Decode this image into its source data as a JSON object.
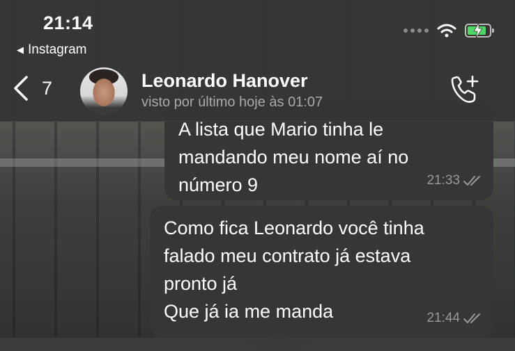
{
  "status_bar": {
    "time": "21:14",
    "back_app_label": "Instagram",
    "back_app_arrow": "◀",
    "icons": [
      "signal-dots-icon",
      "wifi-icon",
      "battery-charging-icon"
    ],
    "battery_color": "#4cd964"
  },
  "header": {
    "back_icon": "chevron-left-icon",
    "unread_count": "7",
    "contact_name": "Leonardo Hanover",
    "last_seen": "visto por último hoje às 01:07",
    "call_icon": "phone-add-icon"
  },
  "messages": [
    {
      "direction": "outgoing",
      "lines": [
        "A lista que Mario tinha le",
        "mandando meu nome aí no",
        "número 9"
      ],
      "time": "21:33",
      "status_icon": "double-check-icon"
    },
    {
      "direction": "outgoing",
      "lines": [
        "Como fica Leonardo você tinha",
        "falado meu contrato já estava",
        "pronto já",
        "Que já ia me manda"
      ],
      "time": "21:44",
      "status_icon": "double-check-icon"
    }
  ],
  "colors": {
    "header_bg": "#343634",
    "bubble_bg": "#363636",
    "secondary_text": "#a9aaa9"
  }
}
